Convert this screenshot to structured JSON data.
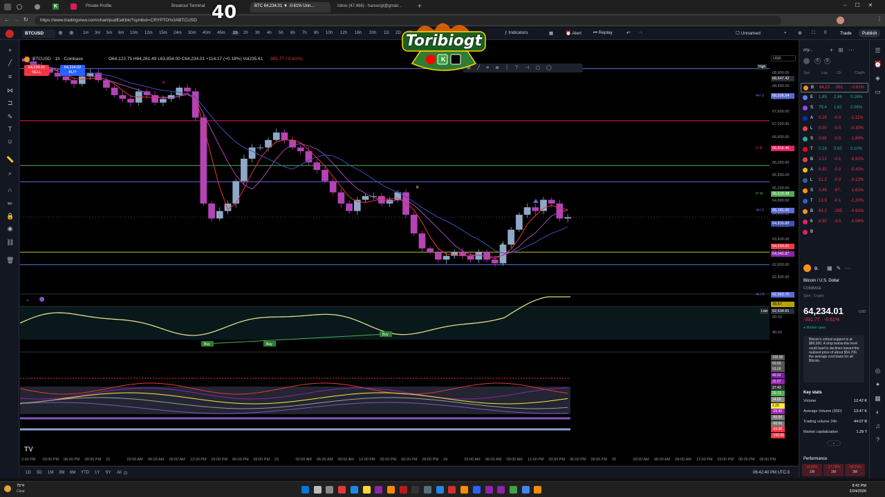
{
  "overlay_number": "40",
  "logo_text": "Toribiogt",
  "browser": {
    "tabs": [
      {
        "label": "Private Profile"
      },
      {
        "label": "Breakout Terminal"
      },
      {
        "label": "BTC 64,234.01 ▼ -0.61% Unn..."
      },
      {
        "label": "Inbox (47,466) - hansergt@gmail..."
      }
    ],
    "url": "https://www.tradingview.com/chart/pudEaKbk/?symbol=CRYPTO%3ABTCUSD"
  },
  "toolbar": {
    "symbol": "BTCUSD",
    "timeframes": [
      "1m",
      "3m",
      "5m",
      "6m",
      "10m",
      "12m",
      "15m",
      "24m",
      "30m",
      "40m",
      "45m",
      "1h",
      "2h",
      "3h",
      "4h",
      "5h",
      "6h",
      "7h",
      "8h",
      "10h",
      "12h",
      "16h",
      "20h",
      "1D",
      "2D",
      "3D",
      "4D",
      "5D"
    ],
    "active_timeframe": "1h",
    "indicators": "Indicators",
    "alert": "Alert",
    "replay": "Replay",
    "layout_name": "Unnamed",
    "trade": "Trade",
    "publish": "Publish"
  },
  "legend": {
    "title": "BTCUSD · 1h · Coinbase",
    "ohlc": "O64,122.75 H64,261.49 L63,854.00 C64,234.01 +114.17 (+0.18%) Vol235.61",
    "change_red": "-391.77 (-0.61%)",
    "sell_price": "64,234.01",
    "sell_label": "SELL",
    "spread": "0.01",
    "buy_price": "64,234.02",
    "buy_label": "BUY"
  },
  "price_axis": {
    "currency": "USD",
    "labels": [
      "68,800.00",
      "68,400.00",
      "68,000.00",
      "67,600.00",
      "67,200.00",
      "66,800.00",
      "66,400.00",
      "66,000.00",
      "65,600.00",
      "65,200.00",
      "64,800.00",
      "64,400.00",
      "64,000.00",
      "63,600.00",
      "63,200.00",
      "62,800.00",
      "62,400.00"
    ],
    "high_tag": "68,647.42",
    "high_label": "High",
    "low_tag": "62,534.61",
    "low_label": "Low",
    "tags": [
      {
        "label": "4H S",
        "value": "68,206.54",
        "color": "#5b6bd6"
      },
      {
        "label": "D R",
        "value": "66,816.46",
        "color": "#e91e63"
      },
      {
        "label": "R W",
        "value": "65,618.48",
        "color": "#4caf50"
      },
      {
        "label": "4H S",
        "value": "65,181.00",
        "color": "#5b6bd6"
      },
      {
        "label": "",
        "value": "64,830.80",
        "color": "#3f51b5"
      },
      {
        "label": "",
        "value": "64,234.01",
        "color": "#f23645"
      },
      {
        "label": "",
        "value": "64,042.87",
        "color": "#8e24aa"
      },
      {
        "label": "4H R",
        "value": "62,963.76",
        "color": "#5b6bd6"
      }
    ],
    "osc_labels": [
      "78.67",
      "60.00",
      "40.00"
    ],
    "lower_labels": [
      "100.00",
      "60.00",
      "53.00",
      "40.52",
      "31.07",
      "27.43",
      "20.73",
      "14.69",
      "2.25",
      "-26.90",
      "-50.00",
      "-60.00",
      "-93.00",
      "-100.00"
    ]
  },
  "time_axis": [
    "2:00 PM",
    "03:00 PM",
    "06:00 PM",
    "09:00 PM",
    "22",
    "03:00 AM",
    "06:00 AM",
    "09:00 AM",
    "12:00 PM",
    "03:00 PM",
    "06:00 PM",
    "09:00 PM",
    "23",
    "03:00 AM",
    "06:00 AM",
    "09:00 AM",
    "12:00 PM",
    "03:00 PM",
    "06:00 PM",
    "09:00 PM",
    "24",
    "03:00 AM",
    "06:00 AM",
    "09:00 AM",
    "12:00 PM",
    "03:00 PM",
    "06:00 PM",
    "09:00 PM",
    "25",
    "03:00 AM",
    "06:00 AM",
    "09:00 AM",
    "12:00 PM",
    "03:00 PM",
    "06:00 PM",
    "09:00 PM"
  ],
  "bottom_bar": {
    "ranges": [
      "1D",
      "5D",
      "1M",
      "3M",
      "6M",
      "YTD",
      "1Y",
      "5Y",
      "All"
    ],
    "clock": "06:42:40 PM UTC-5"
  },
  "buy_labels": [
    "Buy",
    "Buy",
    "Buy"
  ],
  "watchlist": {
    "title": "cry...",
    "columns": [
      "Syn",
      "Las",
      "Ch",
      "Chg%"
    ],
    "rows": [
      {
        "sym": "B",
        "last": "64,23",
        "ch": "-391",
        "chp": "-0.61%",
        "color": "#f7931a",
        "dir": "down"
      },
      {
        "sym": "E",
        "last": "1,85",
        "ch": "2.96",
        "chp": "0.16%",
        "color": "#627eea",
        "dir": "up"
      },
      {
        "sym": "S",
        "last": "79.4",
        "ch": "1.62",
        "chp": "2.08%",
        "color": "#9945ff",
        "dir": "up"
      },
      {
        "sym": "A",
        "last": "0.29",
        "ch": "-0.0",
        "chp": "-1.11%",
        "color": "#0033ad",
        "dir": "down"
      },
      {
        "sym": "L",
        "last": "0.00",
        "ch": "-0.0",
        "chp": "-0.30%",
        "color": "#e84142",
        "dir": "down"
      },
      {
        "sym": "S",
        "last": "0.86",
        "ch": "-0.0",
        "chp": "-1.89%",
        "color": "#22ab94",
        "dir": "down"
      },
      {
        "sym": "T",
        "last": "0.29",
        "ch": "0.00",
        "chp": "0.10%",
        "color": "#ff0013",
        "dir": "up"
      },
      {
        "sym": "B",
        "last": "3.12",
        "ch": "-0.1",
        "chp": "-5.91%",
        "color": "#e84142",
        "dir": "down"
      },
      {
        "sym": "A",
        "last": "8.30",
        "ch": "-0.0",
        "chp": "-0.42%",
        "color": "#f0b90b",
        "dir": "down"
      },
      {
        "sym": "L",
        "last": "51.2",
        "ch": "-0.0",
        "chp": "-0.12%",
        "color": "#345d9d",
        "dir": "down"
      },
      {
        "sym": "S",
        "last": "3.49",
        "ch": "-57.",
        "chp": "-1.61%",
        "color": "#ff9800",
        "dir": "down"
      },
      {
        "sym": "T",
        "last": "13.9",
        "ch": "-0.1",
        "chp": "-1.20%",
        "color": "#375bd2",
        "dir": "down"
      },
      {
        "sym": "B",
        "last": "64,2",
        "ch": "-295",
        "chp": "-0.61%",
        "color": "#f7931a",
        "dir": "down"
      },
      {
        "sym": "6",
        "last": "6,90",
        "ch": "-3.0",
        "chp": "-0.04%",
        "color": "#e91e63",
        "dir": "down"
      },
      {
        "sym": "B",
        "last": "",
        "ch": "",
        "chp": "",
        "color": "#e91e63",
        "dir": "down"
      }
    ]
  },
  "details": {
    "short": "B.",
    "name": "Bitcoin / U.S. Dollar",
    "exchange": "COINBASE",
    "type": "Spot · Crypto",
    "price": "64,234.01",
    "currency": "USD",
    "change": "-391.77",
    "change_pct": "-0.61%",
    "market_status": "● Market open",
    "news": "Bitcoin's critical support is at $60,000. A drop below this level could lead to declines toward the realized price of about $54,700, the average cost basis for all Bitcoin.",
    "key_stats_title": "Key stats",
    "stats": [
      {
        "label": "Volume",
        "value": "12.42 K"
      },
      {
        "label": "Average Volume (30D)",
        "value": "13.47 K"
      },
      {
        "label": "Trading volume 24h",
        "value": "44.07 B"
      },
      {
        "label": "Market capitalization",
        "value": "1.29 T"
      }
    ],
    "performance_title": "Performance",
    "performance": [
      {
        "value": "-6.98%",
        "period": "1W"
      },
      {
        "value": "-17.79%",
        "period": "1M"
      },
      {
        "value": "-26.73%",
        "period": "3M"
      }
    ]
  },
  "taskbar": {
    "weather": "75°F",
    "weather_desc": "Clear",
    "time": "8:42 PM",
    "date": "2/24/2026"
  },
  "chart_data": {
    "type": "candlestick",
    "symbol": "BTCUSD",
    "interval": "1h",
    "ylim": [
      62400,
      68900
    ],
    "close_series_approx": [
      68400,
      68300,
      68200,
      68100,
      68000,
      67900,
      67800,
      68000,
      68100,
      67900,
      67700,
      67500,
      67400,
      67300,
      67600,
      67500,
      67300,
      67400,
      67500,
      67700,
      67600,
      66900,
      64600,
      64200,
      64400,
      64600,
      65200,
      65800,
      66100,
      66100,
      66300,
      66500,
      66300,
      66100,
      66000,
      65700,
      65500,
      65200,
      64900,
      64600,
      64400,
      64700,
      64800,
      64800,
      64600,
      64700,
      64900,
      64300,
      63800,
      63400,
      63300,
      63100,
      63200,
      63300,
      63200,
      63100,
      63300,
      63100,
      63000,
      63500,
      63900,
      64300,
      64500,
      64400,
      64700,
      64600,
      64200,
      64234
    ],
    "horizontal_levels": [
      68206.54,
      66816.46,
      65618.48,
      65181.0,
      64234.01,
      63300.0,
      62963.76
    ]
  }
}
